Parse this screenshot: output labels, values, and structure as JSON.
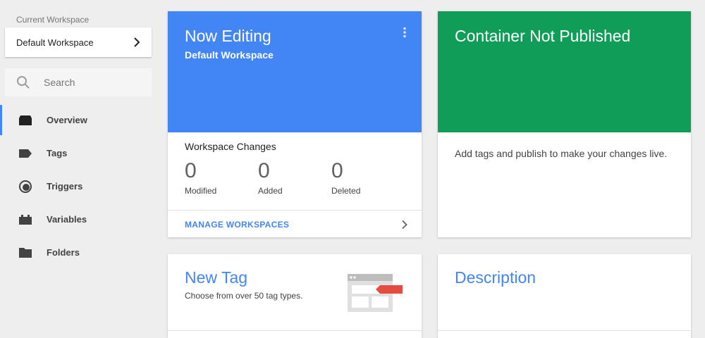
{
  "sidebar": {
    "workspace_label": "Current Workspace",
    "workspace_name": "Default Workspace",
    "search_placeholder": "Search",
    "items": [
      {
        "label": "Overview",
        "icon": "overview-icon",
        "active": true
      },
      {
        "label": "Tags",
        "icon": "tag-icon",
        "active": false
      },
      {
        "label": "Triggers",
        "icon": "trigger-icon",
        "active": false
      },
      {
        "label": "Variables",
        "icon": "variables-icon",
        "active": false
      },
      {
        "label": "Folders",
        "icon": "folder-icon",
        "active": false
      }
    ]
  },
  "editing_card": {
    "title": "Now Editing",
    "subtitle": "Default Workspace",
    "changes_title": "Workspace Changes",
    "stats": [
      {
        "value": "0",
        "label": "Modified"
      },
      {
        "value": "0",
        "label": "Added"
      },
      {
        "value": "0",
        "label": "Deleted"
      }
    ],
    "manage_label": "MANAGE WORKSPACES"
  },
  "publish_card": {
    "title": "Container Not Published",
    "body": "Add tags and publish to make your changes live."
  },
  "new_tag_card": {
    "title": "New Tag",
    "subtitle": "Choose from over 50 tag types."
  },
  "description_card": {
    "title": "Description"
  },
  "colors": {
    "accent_blue": "#4285f4",
    "published_green": "#0f9d58",
    "tag_red": "#e34c3f"
  }
}
